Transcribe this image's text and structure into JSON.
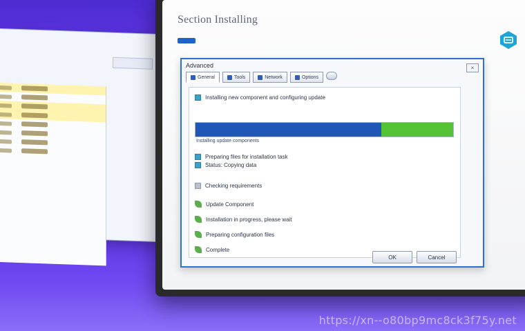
{
  "watermark": "https://xn--o80bp9mc8ck3f75y.net",
  "monitor": {
    "title": "Section Installing",
    "accent_color": "#1e64c8"
  },
  "back_window": {
    "title": "",
    "tab_label": ""
  },
  "dialog": {
    "title": "Advanced",
    "tabs": [
      {
        "label": "General",
        "selected": true
      },
      {
        "label": "Tools",
        "selected": false
      },
      {
        "label": "Network",
        "selected": false
      },
      {
        "label": "Options",
        "selected": false
      }
    ],
    "rows": [
      {
        "icon": "info-square",
        "text": "Installing new component and configuring update"
      },
      {
        "icon": "info-square",
        "text": "Preparing files for installation task"
      },
      {
        "icon": "info-square",
        "text": "Status: Copying data"
      },
      {
        "icon": "info-square",
        "text": "Checking requirements"
      },
      {
        "icon": "leaf",
        "text": "Update Component"
      },
      {
        "icon": "leaf",
        "text": "Installation in progress, please wait"
      },
      {
        "icon": "leaf",
        "text": "Preparing configuration files"
      },
      {
        "icon": "leaf",
        "text": "Complete"
      }
    ],
    "progress": {
      "value_fraction": 0.72,
      "secondary_fraction": 0.28,
      "subtext": "Installing update components"
    },
    "buttons": {
      "ok": "OK",
      "cancel": "Cancel"
    }
  }
}
